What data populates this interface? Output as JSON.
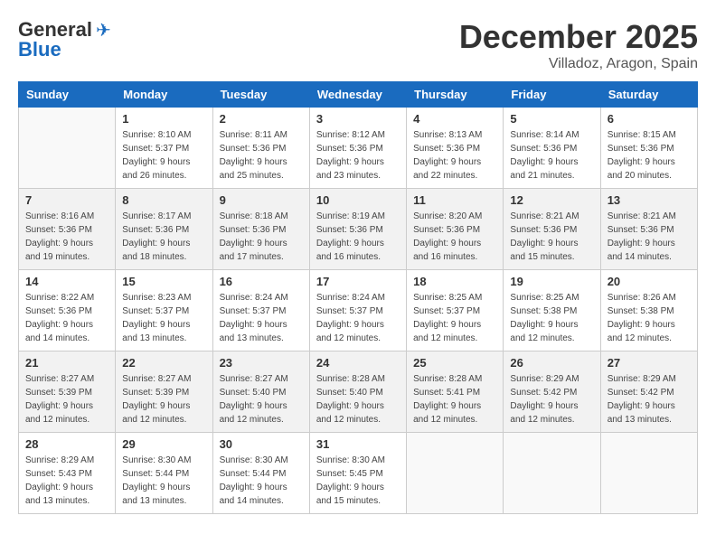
{
  "header": {
    "logo_general": "General",
    "logo_blue": "Blue",
    "month_title": "December 2025",
    "location": "Villadoz, Aragon, Spain"
  },
  "days_of_week": [
    "Sunday",
    "Monday",
    "Tuesday",
    "Wednesday",
    "Thursday",
    "Friday",
    "Saturday"
  ],
  "weeks": [
    [
      {
        "day": "",
        "sunrise": "",
        "sunset": "",
        "daylight": ""
      },
      {
        "day": "1",
        "sunrise": "Sunrise: 8:10 AM",
        "sunset": "Sunset: 5:37 PM",
        "daylight": "Daylight: 9 hours and 26 minutes."
      },
      {
        "day": "2",
        "sunrise": "Sunrise: 8:11 AM",
        "sunset": "Sunset: 5:36 PM",
        "daylight": "Daylight: 9 hours and 25 minutes."
      },
      {
        "day": "3",
        "sunrise": "Sunrise: 8:12 AM",
        "sunset": "Sunset: 5:36 PM",
        "daylight": "Daylight: 9 hours and 23 minutes."
      },
      {
        "day": "4",
        "sunrise": "Sunrise: 8:13 AM",
        "sunset": "Sunset: 5:36 PM",
        "daylight": "Daylight: 9 hours and 22 minutes."
      },
      {
        "day": "5",
        "sunrise": "Sunrise: 8:14 AM",
        "sunset": "Sunset: 5:36 PM",
        "daylight": "Daylight: 9 hours and 21 minutes."
      },
      {
        "day": "6",
        "sunrise": "Sunrise: 8:15 AM",
        "sunset": "Sunset: 5:36 PM",
        "daylight": "Daylight: 9 hours and 20 minutes."
      }
    ],
    [
      {
        "day": "7",
        "sunrise": "Sunrise: 8:16 AM",
        "sunset": "Sunset: 5:36 PM",
        "daylight": "Daylight: 9 hours and 19 minutes."
      },
      {
        "day": "8",
        "sunrise": "Sunrise: 8:17 AM",
        "sunset": "Sunset: 5:36 PM",
        "daylight": "Daylight: 9 hours and 18 minutes."
      },
      {
        "day": "9",
        "sunrise": "Sunrise: 8:18 AM",
        "sunset": "Sunset: 5:36 PM",
        "daylight": "Daylight: 9 hours and 17 minutes."
      },
      {
        "day": "10",
        "sunrise": "Sunrise: 8:19 AM",
        "sunset": "Sunset: 5:36 PM",
        "daylight": "Daylight: 9 hours and 16 minutes."
      },
      {
        "day": "11",
        "sunrise": "Sunrise: 8:20 AM",
        "sunset": "Sunset: 5:36 PM",
        "daylight": "Daylight: 9 hours and 16 minutes."
      },
      {
        "day": "12",
        "sunrise": "Sunrise: 8:21 AM",
        "sunset": "Sunset: 5:36 PM",
        "daylight": "Daylight: 9 hours and 15 minutes."
      },
      {
        "day": "13",
        "sunrise": "Sunrise: 8:21 AM",
        "sunset": "Sunset: 5:36 PM",
        "daylight": "Daylight: 9 hours and 14 minutes."
      }
    ],
    [
      {
        "day": "14",
        "sunrise": "Sunrise: 8:22 AM",
        "sunset": "Sunset: 5:36 PM",
        "daylight": "Daylight: 9 hours and 14 minutes."
      },
      {
        "day": "15",
        "sunrise": "Sunrise: 8:23 AM",
        "sunset": "Sunset: 5:37 PM",
        "daylight": "Daylight: 9 hours and 13 minutes."
      },
      {
        "day": "16",
        "sunrise": "Sunrise: 8:24 AM",
        "sunset": "Sunset: 5:37 PM",
        "daylight": "Daylight: 9 hours and 13 minutes."
      },
      {
        "day": "17",
        "sunrise": "Sunrise: 8:24 AM",
        "sunset": "Sunset: 5:37 PM",
        "daylight": "Daylight: 9 hours and 12 minutes."
      },
      {
        "day": "18",
        "sunrise": "Sunrise: 8:25 AM",
        "sunset": "Sunset: 5:37 PM",
        "daylight": "Daylight: 9 hours and 12 minutes."
      },
      {
        "day": "19",
        "sunrise": "Sunrise: 8:25 AM",
        "sunset": "Sunset: 5:38 PM",
        "daylight": "Daylight: 9 hours and 12 minutes."
      },
      {
        "day": "20",
        "sunrise": "Sunrise: 8:26 AM",
        "sunset": "Sunset: 5:38 PM",
        "daylight": "Daylight: 9 hours and 12 minutes."
      }
    ],
    [
      {
        "day": "21",
        "sunrise": "Sunrise: 8:27 AM",
        "sunset": "Sunset: 5:39 PM",
        "daylight": "Daylight: 9 hours and 12 minutes."
      },
      {
        "day": "22",
        "sunrise": "Sunrise: 8:27 AM",
        "sunset": "Sunset: 5:39 PM",
        "daylight": "Daylight: 9 hours and 12 minutes."
      },
      {
        "day": "23",
        "sunrise": "Sunrise: 8:27 AM",
        "sunset": "Sunset: 5:40 PM",
        "daylight": "Daylight: 9 hours and 12 minutes."
      },
      {
        "day": "24",
        "sunrise": "Sunrise: 8:28 AM",
        "sunset": "Sunset: 5:40 PM",
        "daylight": "Daylight: 9 hours and 12 minutes."
      },
      {
        "day": "25",
        "sunrise": "Sunrise: 8:28 AM",
        "sunset": "Sunset: 5:41 PM",
        "daylight": "Daylight: 9 hours and 12 minutes."
      },
      {
        "day": "26",
        "sunrise": "Sunrise: 8:29 AM",
        "sunset": "Sunset: 5:42 PM",
        "daylight": "Daylight: 9 hours and 12 minutes."
      },
      {
        "day": "27",
        "sunrise": "Sunrise: 8:29 AM",
        "sunset": "Sunset: 5:42 PM",
        "daylight": "Daylight: 9 hours and 13 minutes."
      }
    ],
    [
      {
        "day": "28",
        "sunrise": "Sunrise: 8:29 AM",
        "sunset": "Sunset: 5:43 PM",
        "daylight": "Daylight: 9 hours and 13 minutes."
      },
      {
        "day": "29",
        "sunrise": "Sunrise: 8:30 AM",
        "sunset": "Sunset: 5:44 PM",
        "daylight": "Daylight: 9 hours and 13 minutes."
      },
      {
        "day": "30",
        "sunrise": "Sunrise: 8:30 AM",
        "sunset": "Sunset: 5:44 PM",
        "daylight": "Daylight: 9 hours and 14 minutes."
      },
      {
        "day": "31",
        "sunrise": "Sunrise: 8:30 AM",
        "sunset": "Sunset: 5:45 PM",
        "daylight": "Daylight: 9 hours and 15 minutes."
      },
      {
        "day": "",
        "sunrise": "",
        "sunset": "",
        "daylight": ""
      },
      {
        "day": "",
        "sunrise": "",
        "sunset": "",
        "daylight": ""
      },
      {
        "day": "",
        "sunrise": "",
        "sunset": "",
        "daylight": ""
      }
    ]
  ]
}
